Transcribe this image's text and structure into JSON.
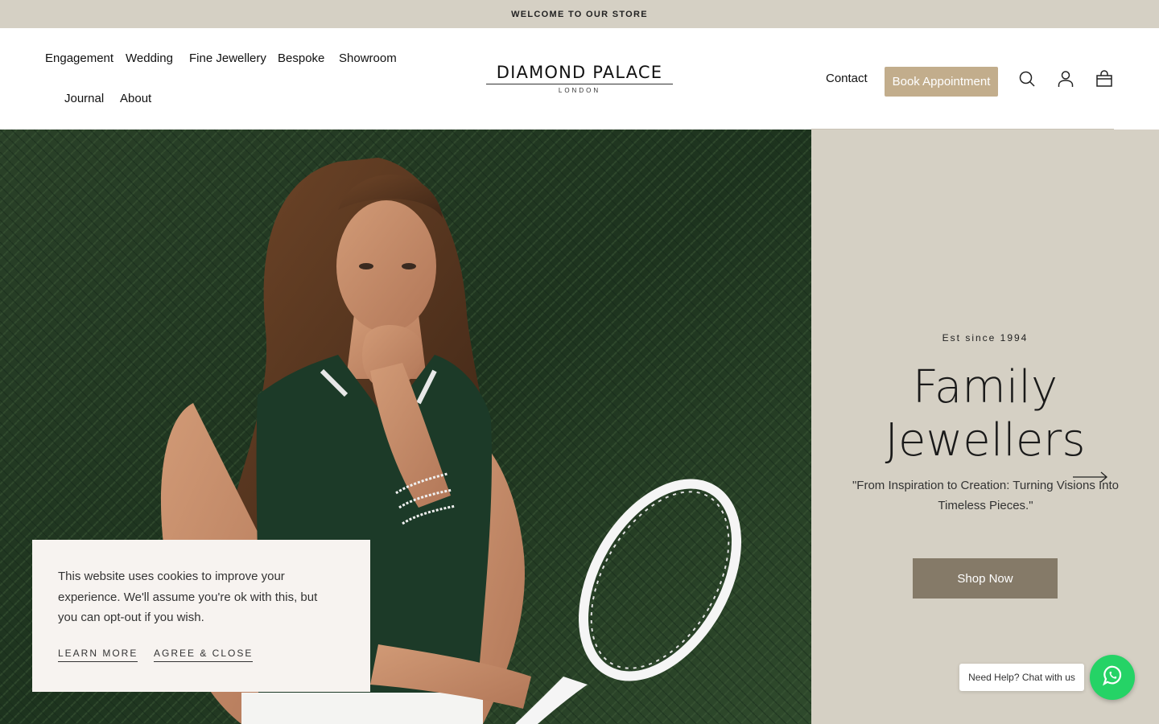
{
  "announcement": {
    "text": "WELCOME TO OUR STORE"
  },
  "nav": {
    "items": [
      {
        "label": "Engagement"
      },
      {
        "label": "Wedding"
      },
      {
        "label": "Fine Jewellery"
      },
      {
        "label": "Bespoke"
      },
      {
        "label": "Showroom"
      },
      {
        "label": "Journal"
      },
      {
        "label": "About"
      }
    ]
  },
  "brand": {
    "name": "DIAMOND PALACE",
    "location": "LONDON"
  },
  "header": {
    "contact_label": "Contact",
    "book_label": "Book Appointment",
    "icons": [
      "search-icon",
      "account-icon",
      "cart-icon"
    ],
    "accent_color": "#c2ad8c"
  },
  "hero": {
    "eyebrow": "Est since 1994",
    "title_line1": "Family",
    "title_line2": "Jewellers",
    "quote": "\"From Inspiration to Creation: Turning Visions Into Timeless Pieces.\"",
    "cta_label": "Shop Now",
    "panel_color": "#d5d0c4",
    "cta_color": "#857a68"
  },
  "cookie": {
    "message": "This website uses cookies to improve your experience. We'll assume you're ok with this, but you can opt-out if you wish.",
    "learn_more": "LEARN MORE",
    "agree": "AGREE & CLOSE"
  },
  "whatsapp": {
    "bubble_text": "Need Help? Chat with us",
    "color": "#25d366"
  }
}
